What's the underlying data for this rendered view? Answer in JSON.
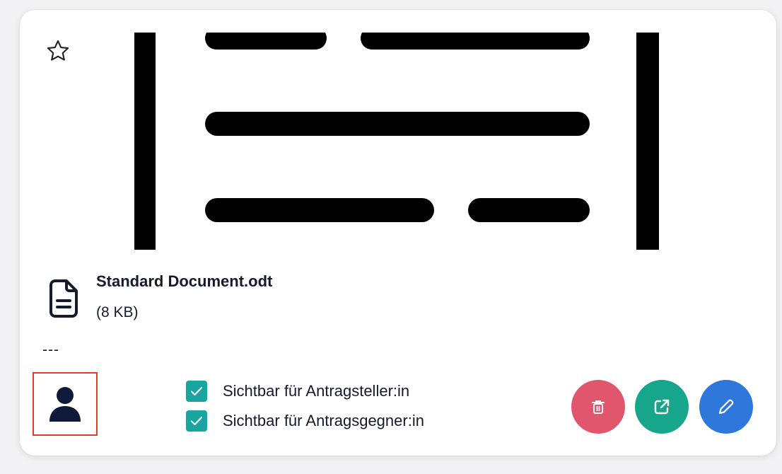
{
  "file": {
    "name": "Standard Document.odt",
    "size": "(8 KB)",
    "separator": "---"
  },
  "visibility": [
    {
      "label": "Sichtbar für Antragsteller:in",
      "checked": true
    },
    {
      "label": "Sichtbar für Antragsgegner:in",
      "checked": true
    }
  ],
  "actions": [
    {
      "name": "delete",
      "icon": "trash-icon",
      "color": "#e0566c"
    },
    {
      "name": "open",
      "icon": "external-link-icon",
      "color": "#17a58c"
    },
    {
      "name": "edit",
      "icon": "pencil-icon",
      "color": "#2f77db"
    }
  ],
  "icons": {
    "favorite": "star-outline-icon",
    "file_type": "document-icon",
    "owner": "person-icon"
  },
  "colors": {
    "checkbox": "#1ba5a0",
    "highlight_border": "#e53a21",
    "text": "#151a2d"
  }
}
